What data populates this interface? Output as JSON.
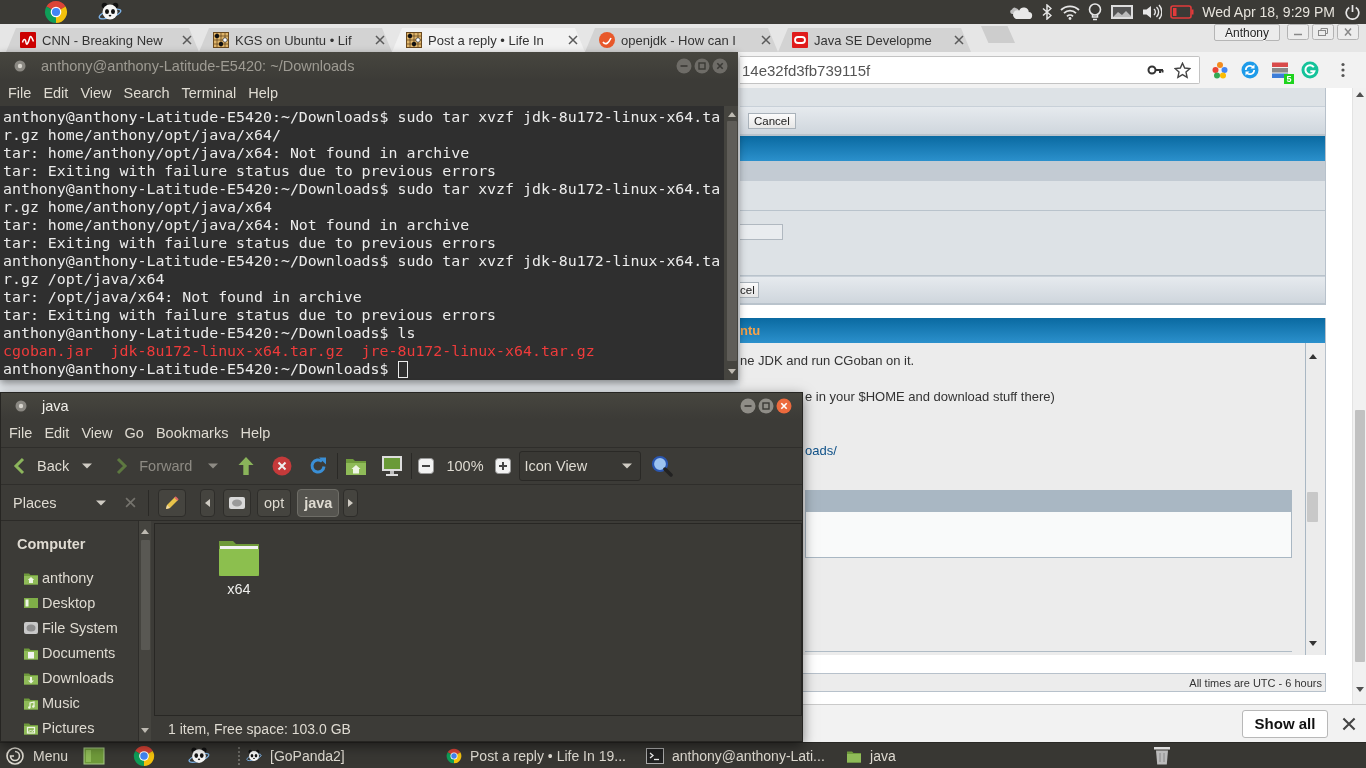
{
  "top_panel": {
    "clock": "Wed Apr 18, 9:29 PM"
  },
  "browser": {
    "tabs": [
      {
        "title": "CNN - Breaking New",
        "kind": "square",
        "selected": false
      },
      {
        "title": "KGS on Ubuntu • Lif",
        "kind": "board",
        "selected": false
      },
      {
        "title": "Post a reply • Life In",
        "kind": "board",
        "selected": true
      },
      {
        "title": "openjdk - How can I",
        "kind": "circle",
        "selected": false
      },
      {
        "title": "Java SE Developme",
        "kind": "ring",
        "selected": false
      }
    ],
    "profile": "Anthony",
    "address": "14e32fd3fb739115f",
    "extension_badge": "5",
    "page": {
      "top_button": "Cancel",
      "bottom_button": "cel",
      "section_title": "ntu",
      "review_lines": [
        {
          "kind": "text",
          "text": "ne JDK and run CGoban on it."
        },
        {
          "kind": "text",
          "text": "e in your $HOME and download stuff there)"
        },
        {
          "kind": "link",
          "text": "oads/"
        }
      ],
      "footer": "All times are UTC - 6 hours"
    },
    "download_bar": {
      "button": "Show all"
    }
  },
  "terminal": {
    "title": "anthony@anthony-Latitude-E5420: ~/Downloads",
    "active": false,
    "menu": [
      "File",
      "Edit",
      "View",
      "Search",
      "Terminal",
      "Help"
    ],
    "lines": [
      {
        "kind": "output",
        "text": "anthony@anthony-Latitude-E5420:~/Downloads$ sudo tar xvzf jdk-8u172-linux-x64.ta"
      },
      {
        "kind": "output",
        "text": "r.gz home/anthony/opt/java/x64/"
      },
      {
        "kind": "output",
        "text": "tar: home/anthony/opt/java/x64: Not found in archive"
      },
      {
        "kind": "output",
        "text": "tar: Exiting with failure status due to previous errors"
      },
      {
        "kind": "output",
        "text": "anthony@anthony-Latitude-E5420:~/Downloads$ sudo tar xvzf jdk-8u172-linux-x64.ta"
      },
      {
        "kind": "output",
        "text": "r.gz home/anthony/opt/java/x64"
      },
      {
        "kind": "output",
        "text": "tar: home/anthony/opt/java/x64: Not found in archive"
      },
      {
        "kind": "output",
        "text": "tar: Exiting with failure status due to previous errors"
      },
      {
        "kind": "output",
        "text": "anthony@anthony-Latitude-E5420:~/Downloads$ sudo tar xvzf jdk-8u172-linux-x64.ta"
      },
      {
        "kind": "output",
        "text": "r.gz /opt/java/x64"
      },
      {
        "kind": "output",
        "text": "tar: /opt/java/x64: Not found in archive"
      },
      {
        "kind": "output",
        "text": "tar: Exiting with failure status due to previous errors"
      },
      {
        "kind": "output",
        "text": "anthony@anthony-Latitude-E5420:~/Downloads$ ls"
      },
      {
        "kind": "listing",
        "text": "cgoban.jar  jdk-8u172-linux-x64.tar.gz  jre-8u172-linux-x64.tar.gz"
      },
      {
        "kind": "prompt",
        "text": "anthony@anthony-Latitude-E5420:~/Downloads$"
      }
    ]
  },
  "file_manager": {
    "title": "java",
    "active": true,
    "menu": [
      "File",
      "Edit",
      "View",
      "Go",
      "Bookmarks",
      "Help"
    ],
    "toolbar": {
      "back": {
        "label": "Back",
        "disabled": false
      },
      "forward": {
        "label": "Forward",
        "disabled": true
      },
      "zoom": "100%",
      "view": "Icon View"
    },
    "places": "Places",
    "path": [
      {
        "label": "opt",
        "selected": false
      },
      {
        "label": "java",
        "selected": true
      }
    ],
    "sidebar": {
      "heading": "Computer",
      "items": [
        {
          "label": "anthony",
          "kind": "home"
        },
        {
          "label": "Desktop",
          "kind": "desktop"
        },
        {
          "label": "File System",
          "kind": "drive"
        },
        {
          "label": "Documents",
          "kind": "documents"
        },
        {
          "label": "Downloads",
          "kind": "downloads"
        },
        {
          "label": "Music",
          "kind": "music"
        },
        {
          "label": "Pictures",
          "kind": "pictures"
        }
      ]
    },
    "items": [
      {
        "name": "x64"
      }
    ],
    "status": "1 item, Free space: 103.0 GB"
  },
  "taskbar": {
    "menu": "Menu",
    "windows": [
      {
        "title": "[GoPanda2]",
        "kind": "app"
      },
      {
        "title": "Post a reply • Life In 19...",
        "kind": "browser"
      },
      {
        "title": "anthony@anthony-Lati...",
        "kind": "terminal"
      },
      {
        "title": "java",
        "kind": "files"
      }
    ]
  }
}
